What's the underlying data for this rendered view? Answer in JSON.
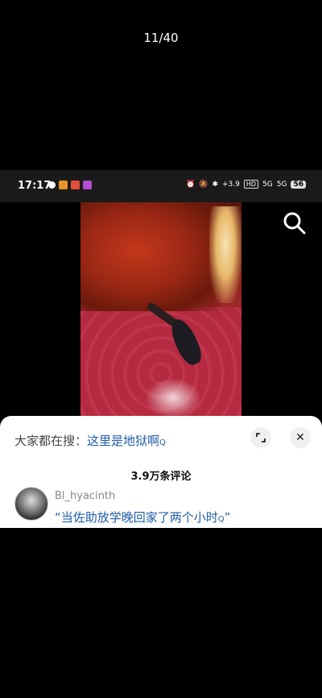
{
  "viewer": {
    "counter": "11/40"
  },
  "status_bar": {
    "time": "17:17",
    "net_speed": "+3.9",
    "hd_badge": "HD",
    "signal1": "5G",
    "signal2": "5G",
    "battery": "56",
    "icons": [
      "location-icon",
      "app-icon-orange",
      "app-icon-red",
      "app-icon-purple",
      "alarm-icon",
      "mute-icon",
      "bluetooth-icon"
    ]
  },
  "search": {
    "prefix": "大家都在搜：",
    "keyword": "这里是地狱啊",
    "keyword_icon": "Q"
  },
  "comments": {
    "count_label": "3.9万条评论",
    "first": {
      "user": "Bl_hyacinth",
      "text": "“当佐助放学晚回家了两个小时",
      "text_icon": "Q",
      "close_quote": "”"
    }
  }
}
